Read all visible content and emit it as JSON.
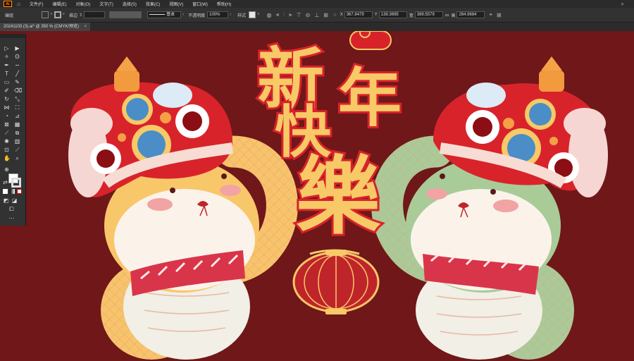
{
  "app": {
    "logo_text": "Ai",
    "home_icon": "home-icon"
  },
  "menu": {
    "items": [
      "文件(F)",
      "编辑(E)",
      "对象(O)",
      "文字(T)",
      "选择(S)",
      "效果(C)",
      "视图(V)",
      "窗口(W)",
      "帮助(H)"
    ],
    "right_icons": [
      "search-icon",
      "more-icon"
    ]
  },
  "control": {
    "group_label": "编组",
    "stroke_label": "描边",
    "brush_value": "基本",
    "opacity_label": "不透明度",
    "opacity_value": "100%",
    "style_label": "样式",
    "x_label": "X",
    "x_value": "367.8479",
    "y_label": "Y",
    "y_value": "139.3695",
    "w_label": "宽",
    "w_value": "389.5579",
    "h_label": "高",
    "h_value": "284.9684"
  },
  "doc_tab": {
    "title": "20241103 (3).ai* @ 350 % (CMYK/预览)",
    "close": "×"
  },
  "artwork": {
    "characters": [
      "新",
      "年",
      "快",
      "樂"
    ]
  },
  "colors": {
    "background": "#6f1719",
    "gold": "#f7c967",
    "red": "#c0242b",
    "green_snake": "#a9cb98",
    "yellow_snake": "#f7c46c"
  }
}
